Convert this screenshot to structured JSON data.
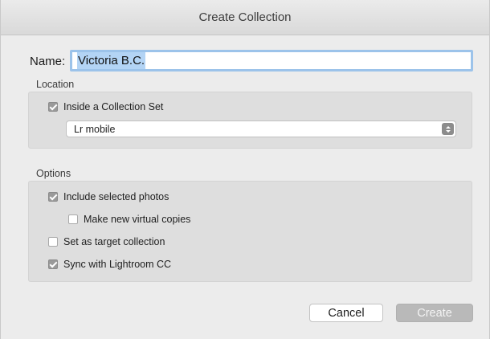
{
  "window": {
    "title": "Create Collection"
  },
  "name_field": {
    "label": "Name:",
    "value": "Victoria B.C."
  },
  "location": {
    "section_label": "Location",
    "inside_collection_set": {
      "label": "Inside a Collection Set",
      "checked": true
    },
    "collection_set_select": {
      "selected": "Lr mobile"
    }
  },
  "options": {
    "section_label": "Options",
    "include_selected_photos": {
      "label": "Include selected photos",
      "checked": true
    },
    "make_new_virtual_copies": {
      "label": "Make new virtual copies",
      "checked": false
    },
    "set_as_target_collection": {
      "label": "Set as target collection",
      "checked": false
    },
    "sync_with_lightroom": {
      "label": "Sync with Lightroom CC",
      "checked": true
    }
  },
  "buttons": {
    "cancel_label": "Cancel",
    "create_label": "Create"
  },
  "colors": {
    "accent_focus_ring": "#9cc3ea",
    "text_selection": "#b3d4f5",
    "checkbox_checked": "#9a9a9a",
    "disabled_button": "#b9b9b9"
  }
}
